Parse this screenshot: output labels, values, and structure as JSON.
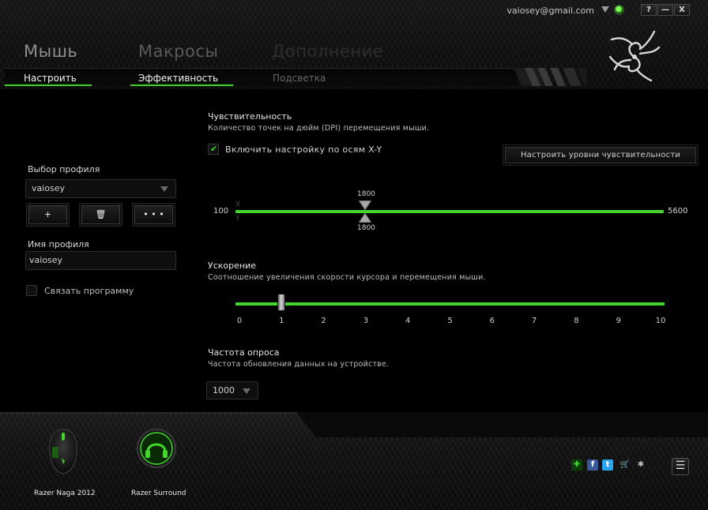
{
  "titlebar": {
    "email": "vaiosey@gmail.com",
    "help_label": "?",
    "minimize_label": "—",
    "close_label": "X"
  },
  "main_tabs": [
    {
      "label": "Мышь",
      "state": "active"
    },
    {
      "label": "Макросы",
      "state": "inactive"
    },
    {
      "label": "Дополнение",
      "state": "inactive"
    }
  ],
  "sub_tabs": [
    {
      "label": "Настроить",
      "state": "active"
    },
    {
      "label": "Эффективность",
      "state": "active"
    },
    {
      "label": "Подсветка",
      "state": "inactive"
    }
  ],
  "profile": {
    "select_label": "Выбор профиля",
    "selected": "vaiosey",
    "add_label": "+",
    "delete_label": "🗑",
    "more_label": "• • •",
    "name_label": "Имя профиля",
    "name_value": "vaiosey",
    "link_program_label": "Связать программу",
    "link_program_checked": false
  },
  "sensitivity": {
    "title": "Чувствительность",
    "description": "Количество точек на дюйм (DPI) перемещения мыши.",
    "xy_checkbox_label": "Включить настройку по осям X-Y",
    "xy_enabled": true,
    "levels_button": "Настроить уровни чувствительности",
    "min_label": "100",
    "max_label": "5600",
    "min": 100,
    "max": 5600,
    "x_value": 1800,
    "y_value": 1800,
    "x_value_label": "1800",
    "y_value_label": "1800",
    "x_axis": "X",
    "y_axis": "Y"
  },
  "acceleration": {
    "title": "Ускорение",
    "description": "Соотношение увеличения скорости курсора и перемещения мыши.",
    "value": 1,
    "min": 0,
    "max": 10,
    "ticks": [
      "0",
      "1",
      "2",
      "3",
      "4",
      "5",
      "6",
      "7",
      "8",
      "9",
      "10"
    ]
  },
  "polling": {
    "title": "Частота опроса",
    "description": "Частота обновления данных на устройстве.",
    "selected": "1000"
  },
  "devices": [
    {
      "name": "Razer Naga 2012",
      "icon": "mouse-icon"
    },
    {
      "name": "Razer Surround",
      "icon": "headphones-icon"
    }
  ],
  "footer_icons": [
    "gift-icon",
    "facebook-icon",
    "twitter-icon",
    "cart-icon",
    "razer-icon"
  ],
  "menu_label": "☰",
  "colors": {
    "accent": "#44d62c",
    "background": "#000000"
  }
}
